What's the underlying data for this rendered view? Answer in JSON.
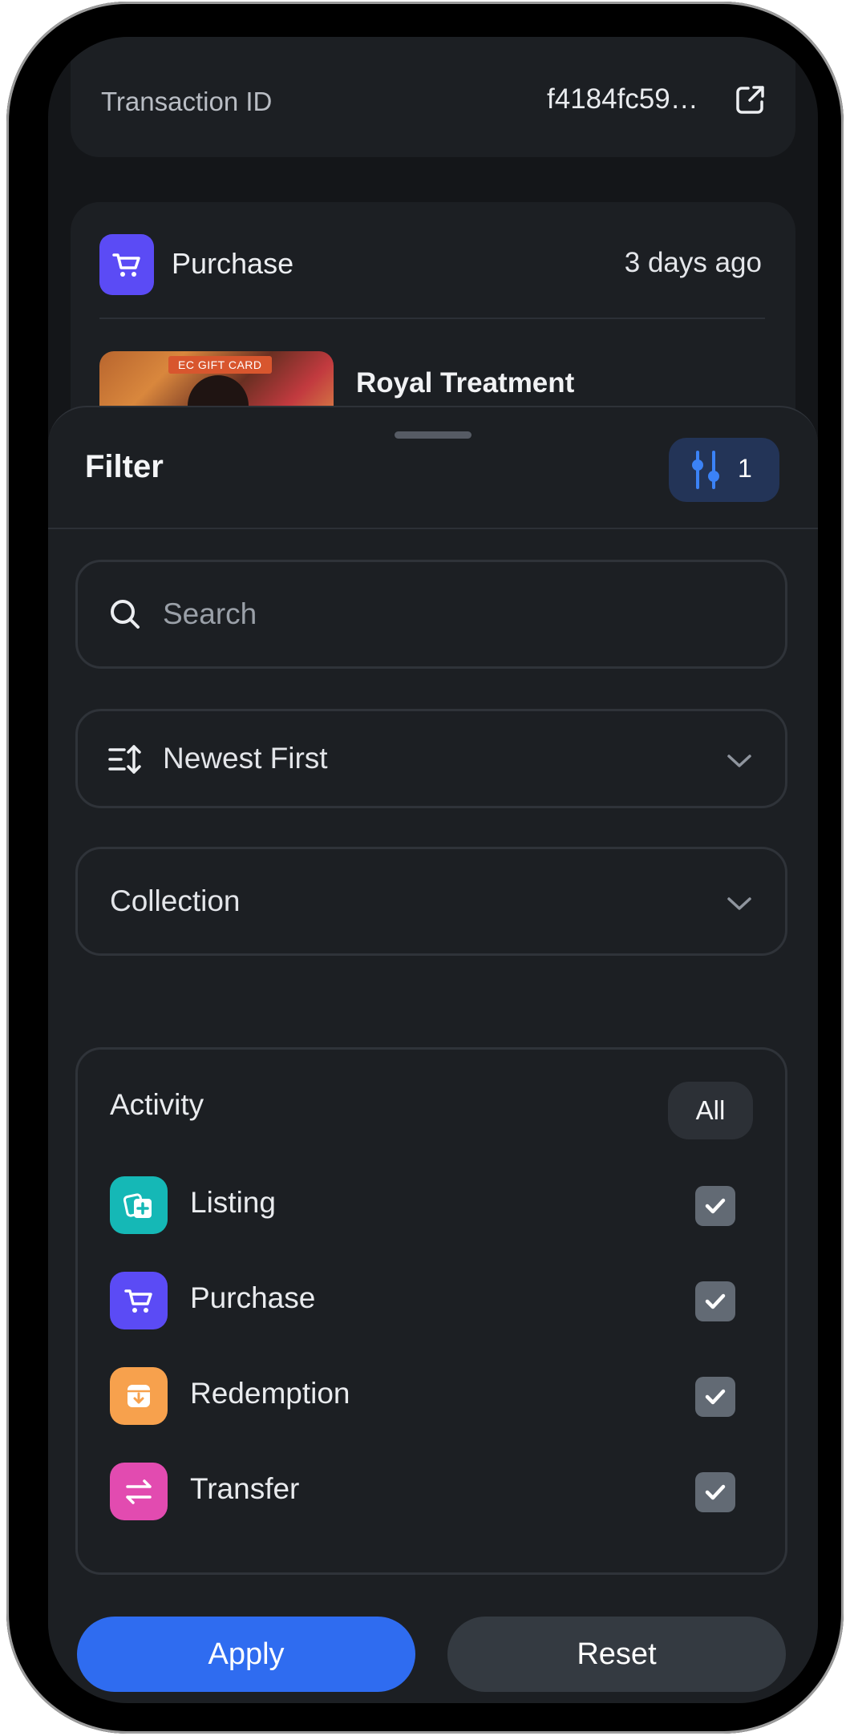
{
  "transaction": {
    "label": "Transaction ID",
    "value": "f4184fc59…"
  },
  "activity_item": {
    "type": "Purchase",
    "time": "3 days ago",
    "nft_badge": "EC GIFT CARD",
    "nft_title": "Royal Treatment"
  },
  "filter": {
    "title": "Filter",
    "active_count": "1",
    "search_placeholder": "Search",
    "sort_value": "Newest First",
    "collection_placeholder": "Collection",
    "activity_title": "Activity",
    "all_label": "All",
    "options": [
      {
        "label": "Listing",
        "color": "#15b8b6",
        "icon": "listing-icon",
        "checked": true
      },
      {
        "label": "Purchase",
        "color": "#5b4bf5",
        "icon": "cart-icon",
        "checked": true
      },
      {
        "label": "Redemption",
        "color": "#f7a14d",
        "icon": "redeem-icon",
        "checked": true
      },
      {
        "label": "Transfer",
        "color": "#e24bb0",
        "icon": "transfer-icon",
        "checked": true
      }
    ],
    "apply_label": "Apply",
    "reset_label": "Reset"
  },
  "colors": {
    "background": "#141619",
    "card": "#1c1f23",
    "accent": "#2f6cf0"
  }
}
